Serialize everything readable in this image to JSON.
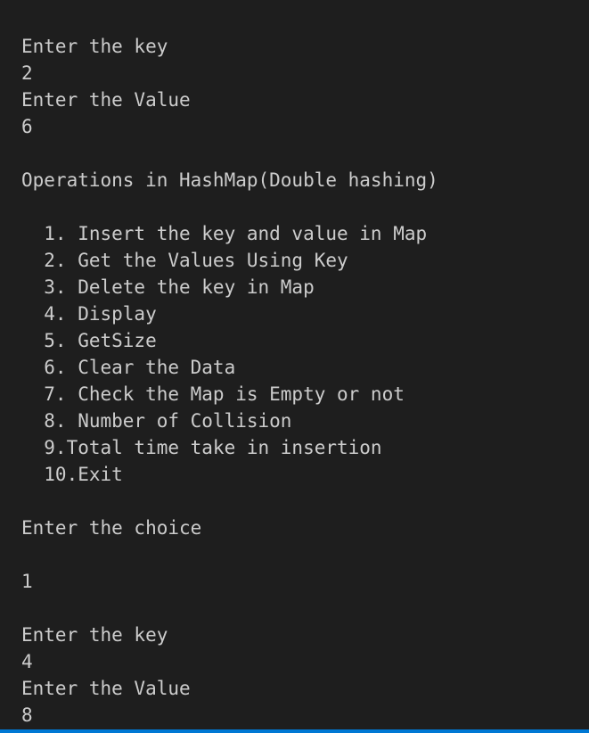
{
  "terminal": {
    "lines": [
      "Enter the key",
      "2",
      "Enter the Value",
      "6",
      "",
      "Operations in HashMap(Double hashing)",
      "",
      "  1. Insert the key and value in Map",
      "  2. Get the Values Using Key",
      "  3. Delete the key in Map",
      "  4. Display",
      "  5. GetSize",
      "  6. Clear the Data",
      "  7. Check the Map is Empty or not",
      "  8. Number of Collision",
      "  9.Total time take in insertion",
      "  10.Exit",
      "",
      "Enter the choice",
      "",
      "1",
      "",
      "Enter the key",
      "4",
      "Enter the Value",
      "8"
    ]
  },
  "colors": {
    "background": "#1e1e1e",
    "text": "#cccccc",
    "accent_border": "#0078d4"
  }
}
